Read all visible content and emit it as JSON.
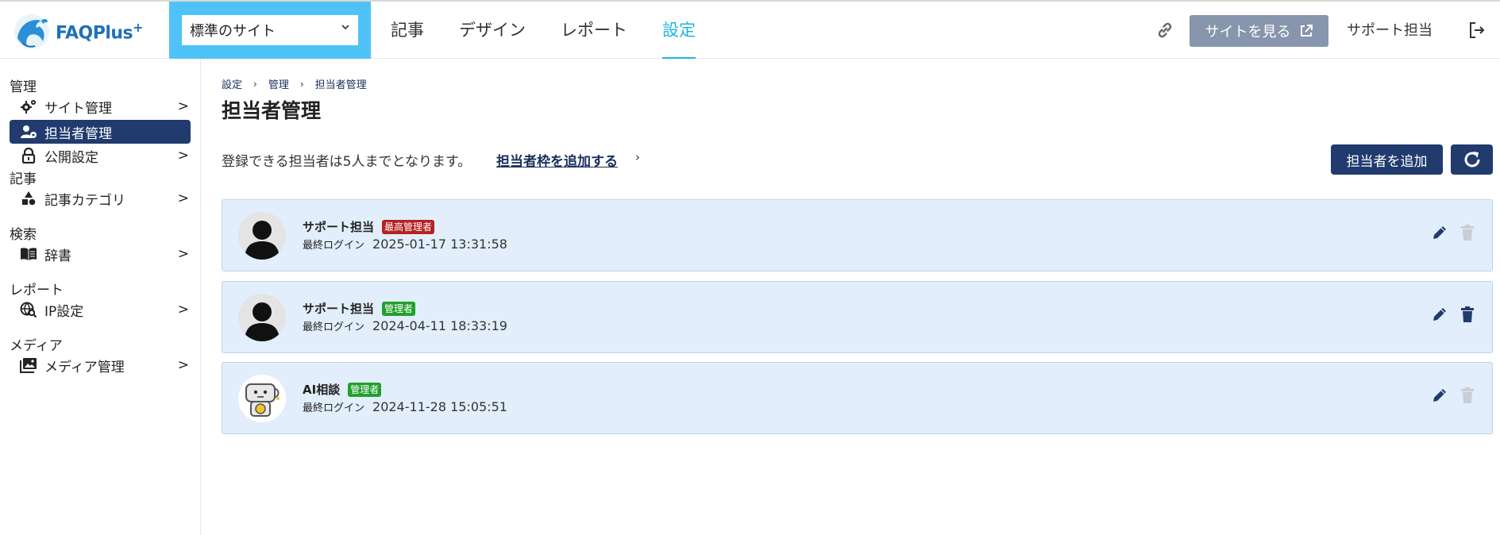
{
  "header": {
    "logo_text": "FAQPlus",
    "logo_sup": "+",
    "site_select": "標準のサイト",
    "nav": [
      {
        "label": "記事",
        "active": false
      },
      {
        "label": "デザイン",
        "active": false
      },
      {
        "label": "レポート",
        "active": false
      },
      {
        "label": "設定",
        "active": true
      }
    ],
    "view_site_label": "サイトを見る",
    "user_name": "サポート担当"
  },
  "sidebar": {
    "groups": [
      {
        "label": "管理",
        "items": [
          {
            "label": "サイト管理",
            "icon": "gears-icon",
            "arrow": ">",
            "active": false
          },
          {
            "label": "担当者管理",
            "icon": "user-gear-icon",
            "arrow": "",
            "active": true
          },
          {
            "label": "公開設定",
            "icon": "lock-icon",
            "arrow": ">",
            "active": false
          }
        ]
      },
      {
        "label": "記事",
        "items": [
          {
            "label": "記事カテゴリ",
            "icon": "shapes-icon",
            "arrow": ">",
            "active": false
          }
        ]
      },
      {
        "label": "検索",
        "items": [
          {
            "label": "辞書",
            "icon": "book-icon",
            "arrow": ">",
            "active": false
          }
        ]
      },
      {
        "label": "レポート",
        "items": [
          {
            "label": "IP設定",
            "icon": "globe-search-icon",
            "arrow": ">",
            "active": false
          }
        ]
      },
      {
        "label": "メディア",
        "items": [
          {
            "label": "メディア管理",
            "icon": "images-icon",
            "arrow": ">",
            "active": false
          }
        ]
      }
    ]
  },
  "main": {
    "breadcrumb": [
      "設定",
      "管理",
      "担当者管理"
    ],
    "title": "担当者管理",
    "info_text": "登録できる担当者は5人までとなります。",
    "add_slot_link": "担当者枠を追加する",
    "add_button": "担当者を追加",
    "users": [
      {
        "name": "サポート担当",
        "badge": "最高管理者",
        "badge_color": "#b52121",
        "login_label": "最終ログイン",
        "last_login": "2025-01-17 13:31:58",
        "avatar": "person-silhouette",
        "can_delete": false
      },
      {
        "name": "サポート担当",
        "badge": "管理者",
        "badge_color": "#21a02b",
        "login_label": "最終ログイン",
        "last_login": "2024-04-11 18:33:19",
        "avatar": "person-silhouette",
        "can_delete": true
      },
      {
        "name": "AI相談",
        "badge": "管理者",
        "badge_color": "#21a02b",
        "login_label": "最終ログイン",
        "last_login": "2024-11-28 15:05:51",
        "avatar": "robot",
        "can_delete": false
      }
    ]
  },
  "colors": {
    "accent": "#21b5e0",
    "navy": "#213b6e",
    "card_bg": "#e2eefb",
    "select_bg": "#4fc3f7"
  }
}
